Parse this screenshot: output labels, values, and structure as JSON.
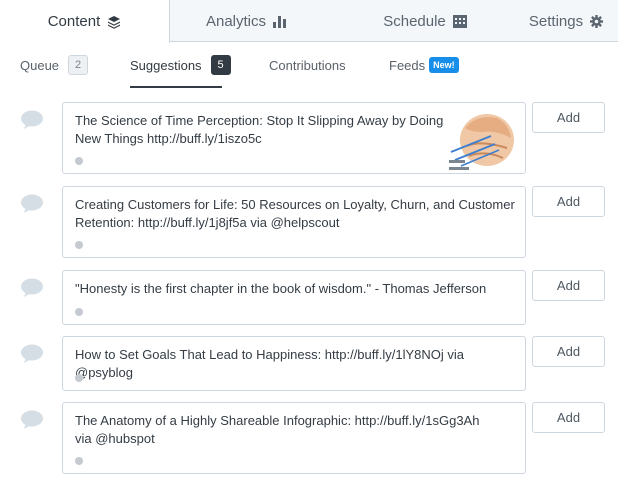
{
  "top_tabs": [
    {
      "label": "Content",
      "icon": "stack-icon",
      "active": true
    },
    {
      "label": "Analytics",
      "icon": "bar-chart-icon",
      "active": false
    },
    {
      "label": "Schedule",
      "icon": "calendar-icon",
      "active": false
    },
    {
      "label": "Settings",
      "icon": "gear-icon",
      "active": false
    }
  ],
  "sub_tabs": [
    {
      "label": "Queue",
      "count": "2"
    },
    {
      "label": "Suggestions",
      "count": "5",
      "active": true
    },
    {
      "label": "Contributions"
    },
    {
      "label": "Feeds",
      "badge": "New!"
    }
  ],
  "add_label": "Add",
  "suggestions": [
    {
      "text": "The Science of Time Perception: Stop It Slipping Away by Doing New Things http://buff.ly/1iszo5c",
      "has_image": true
    },
    {
      "text": "Creating Customers for Life: 50 Resources on Loyalty, Churn, and Customer Retention: http://buff.ly/1j8jf5a via @helpscout"
    },
    {
      "text": "\"Honesty is the first chapter in the book of wisdom.\" - Thomas Jefferson"
    },
    {
      "text": "How to Set Goals That Lead to Happiness: http://buff.ly/1lY8NOj via @psyblog"
    },
    {
      "text": "The Anatomy of a Highly Shareable Infographic: http://buff.ly/1sGg3Ah via @hubspot"
    }
  ],
  "colors": {
    "accent": "#168eea",
    "dark": "#323b43",
    "border": "#ced7df",
    "tab_bg": "#f4f7f9"
  }
}
